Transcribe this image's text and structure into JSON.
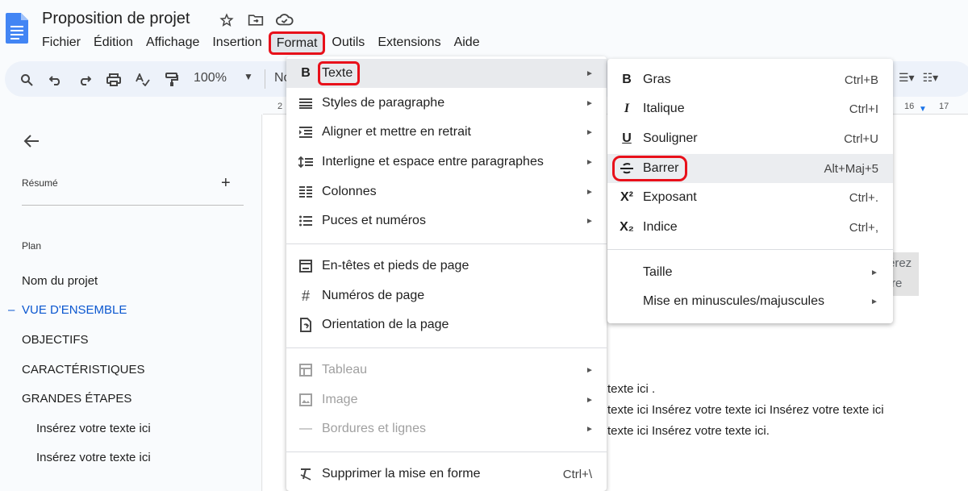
{
  "doc": {
    "title": "Proposition de projet",
    "menubar": [
      "Fichier",
      "Édition",
      "Affichage",
      "Insertion",
      "Format",
      "Outils",
      "Extensions",
      "Aide"
    ],
    "active_menu": "Format"
  },
  "toolbar": {
    "zoom": "100%",
    "style_partial": "No"
  },
  "ruler": {
    "numbers": [
      "2",
      "16",
      "17"
    ]
  },
  "left_panel": {
    "summary_label": "Résumé",
    "add_symbol": "+",
    "plan_label": "Plan",
    "outline": [
      {
        "label": "Nom du projet",
        "active": false,
        "indent": false
      },
      {
        "label": "VUE D'ENSEMBLE",
        "active": true,
        "indent": false
      },
      {
        "label": "OBJECTIFS",
        "active": false,
        "indent": false
      },
      {
        "label": "CARACTÉRISTIQUES",
        "active": false,
        "indent": false
      },
      {
        "label": "GRANDES ÉTAPES",
        "active": false,
        "indent": false
      },
      {
        "label": "Insérez votre texte ici",
        "active": false,
        "indent": true
      },
      {
        "label": "Insérez votre texte ici",
        "active": false,
        "indent": true
      }
    ]
  },
  "document": {
    "line1": "texte ici .",
    "line2": "texte ici Insérez votre texte ici Insérez votre texte ici",
    "line3": "texte ici Insérez votre texte ici.",
    "fragment1": "érez",
    "fragment2": "re"
  },
  "format_menu": {
    "items": [
      {
        "label": "Texte",
        "icon": "bold-b-icon",
        "submenu": true
      },
      {
        "label": "Styles de paragraphe",
        "icon": "paragraph-styles-icon",
        "submenu": true
      },
      {
        "label": "Aligner et mettre en retrait",
        "icon": "align-indent-icon",
        "submenu": true
      },
      {
        "label": "Interligne et espace entre paragraphes",
        "icon": "line-spacing-icon",
        "submenu": true
      },
      {
        "label": "Colonnes",
        "icon": "columns-icon",
        "submenu": true
      },
      {
        "label": "Puces et numéros",
        "icon": "bullets-icon",
        "submenu": true
      },
      {
        "label": "En-têtes et pieds de page",
        "icon": "header-footer-icon",
        "submenu": false
      },
      {
        "label": "Numéros de page",
        "icon": "hash-icon",
        "submenu": false
      },
      {
        "label": "Orientation de la page",
        "icon": "page-orientation-icon",
        "submenu": false
      },
      {
        "label": "Tableau",
        "icon": "table-icon",
        "submenu": true,
        "disabled": true
      },
      {
        "label": "Image",
        "icon": "image-icon",
        "submenu": true,
        "disabled": true
      },
      {
        "label": "Bordures et lignes",
        "icon": "borders-icon",
        "submenu": true,
        "disabled": true
      },
      {
        "label": "Supprimer la mise en forme",
        "icon": "clear-formatting-icon",
        "shortcut": "Ctrl+\\"
      }
    ]
  },
  "text_submenu": {
    "items": [
      {
        "label": "Gras",
        "icon": "B",
        "shortcut": "Ctrl+B"
      },
      {
        "label": "Italique",
        "icon": "I",
        "shortcut": "Ctrl+I"
      },
      {
        "label": "Souligner",
        "icon": "U",
        "shortcut": "Ctrl+U"
      },
      {
        "label": "Barrer",
        "icon": "strikethrough-icon",
        "shortcut": "Alt+Maj+5"
      },
      {
        "label": "Exposant",
        "icon": "X²",
        "shortcut": "Ctrl+."
      },
      {
        "label": "Indice",
        "icon": "X₂",
        "shortcut": "Ctrl+,"
      },
      {
        "label": "Taille",
        "submenu": true
      },
      {
        "label": "Mise en minuscules/majuscules",
        "submenu": true
      }
    ]
  },
  "colors": {
    "highlight_red": "#e8101a",
    "accent_blue": "#0b57d0",
    "doc_icon_blue": "#4285f4"
  }
}
